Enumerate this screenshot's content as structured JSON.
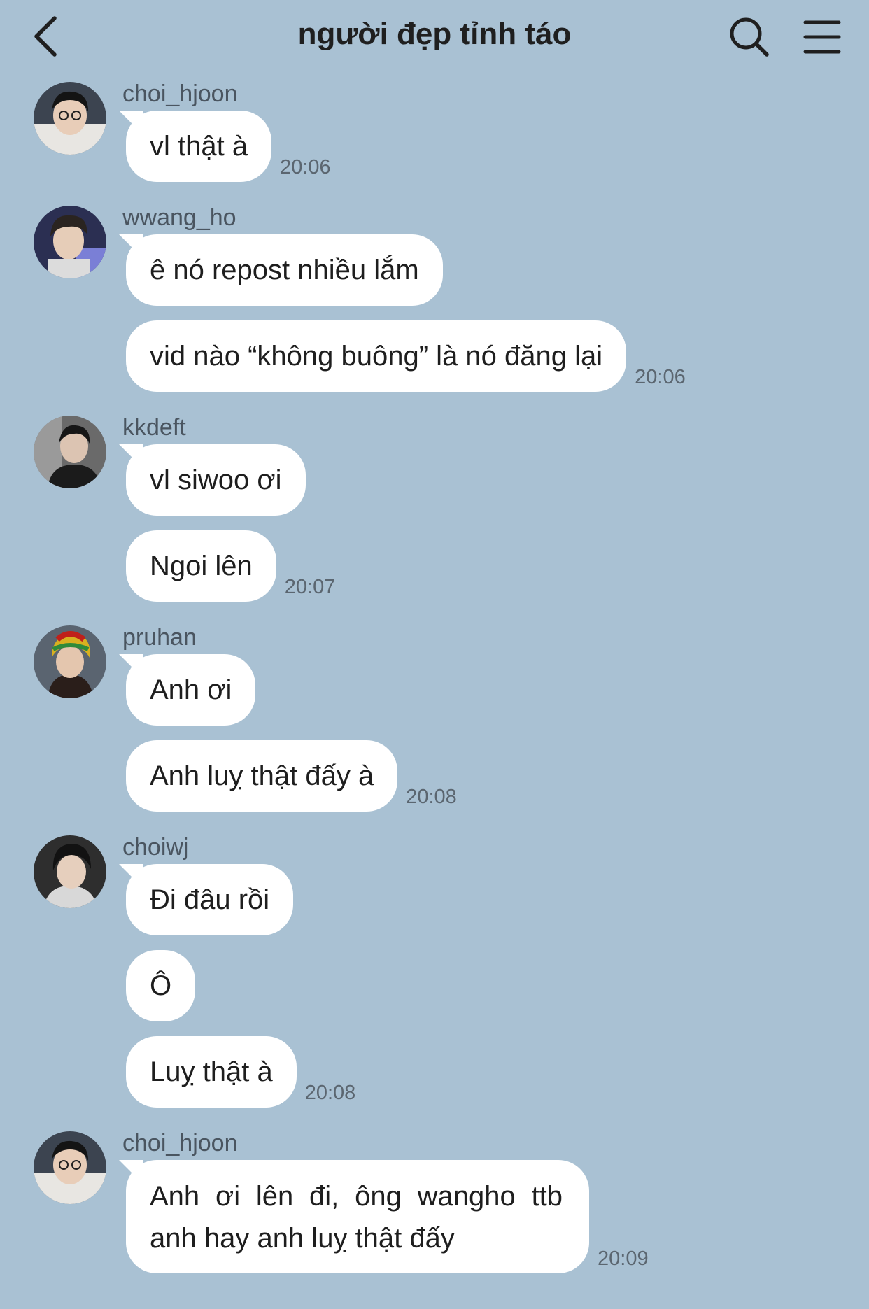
{
  "header": {
    "title": "người đẹp tỉnh táo"
  },
  "groups": [
    {
      "sender": "choi_hjoon",
      "messages": [
        "vl thật à"
      ],
      "time": "20:06",
      "avatar_bg": "#3c4450"
    },
    {
      "sender": "wwang_ho",
      "messages": [
        "ê nó repost nhiều lắm",
        "vid nào “không buông” là nó đăng lại"
      ],
      "time": "20:06",
      "avatar_bg": "#2b2f52"
    },
    {
      "sender": "kkdeft",
      "messages": [
        "vl siwoo ơi",
        "Ngoi lên"
      ],
      "time": "20:07",
      "avatar_bg": "#3b3b3b"
    },
    {
      "sender": "pruhan",
      "messages": [
        "Anh ơi",
        "Anh luỵ thật đấy à"
      ],
      "time": "20:08",
      "avatar_bg": "#5a6470"
    },
    {
      "sender": "choiwj",
      "messages": [
        "Đi đâu rồi",
        "Ô",
        "Luỵ thật à"
      ],
      "time": "20:08",
      "avatar_bg": "#2e2e2e"
    },
    {
      "sender": "choi_hjoon",
      "messages": [
        "Anh ơi lên đi, ông wangho ttb anh hay anh luỵ thật đấy"
      ],
      "time": "20:09",
      "avatar_bg": "#3c4450"
    }
  ],
  "colors": {
    "background": "#a9c1d3",
    "bubble": "#ffffff",
    "text": "#1e1e1e"
  },
  "icons": {
    "back": "chevron-left-icon",
    "search": "search-icon",
    "menu": "hamburger-menu-icon"
  }
}
